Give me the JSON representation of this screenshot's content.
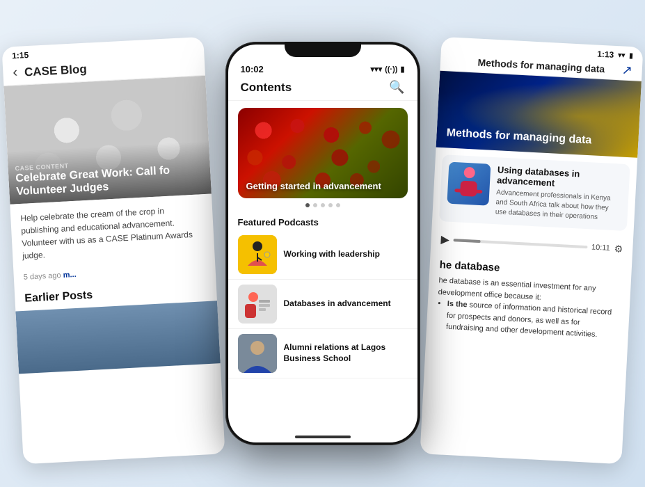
{
  "left_card": {
    "status_time": "1:15",
    "title": "CASE Blog",
    "hero_label": "CASE CONTENT",
    "hero_title": "Celebrate Great Work: Call fo Volunteer Judges",
    "body_text": "Help celebrate the cream of the crop in publishing and educational advancement. Volunteer with us as a CASE Platinum Awards judge.",
    "meta_time": "5 days ago",
    "more_label": "m...",
    "section_title": "Earlier Posts"
  },
  "center_phone": {
    "status_time": "10:02",
    "wifi_icon": "▾",
    "battery_icon": "▮",
    "app_title": "Contents",
    "search_icon": "🔍",
    "slide_label": "Getting started in advancement",
    "dots": [
      "active",
      "inactive",
      "inactive",
      "inactive",
      "inactive"
    ],
    "section_header": "Featured Podcasts",
    "podcasts": [
      {
        "label": "Working with leadership",
        "thumb_type": "yellow-bg",
        "figure_char": "♀"
      },
      {
        "label": "Databases in advancement",
        "thumb_type": "grey-bg",
        "figure_char": ""
      },
      {
        "label": "Alumni relations at Lagos Business School",
        "thumb_type": "photo-bg",
        "figure_char": ""
      }
    ]
  },
  "right_card": {
    "status_time": "1:13",
    "title": "Methods for managing data",
    "share_icon": "↗",
    "banner_text": "Methods for managing data",
    "podcast_title": "Using databases in advancement",
    "podcast_desc": "Advancement professionals in Kenya and South Africa talk about how they use databases in their operations",
    "time_display": "10:11",
    "section_title": "he database",
    "db_intro": "he database is an essential investment for any development office because it:",
    "db_points": [
      "Is the source of information and historical record for prospects and donors, as well as for fundraising and other development activities."
    ]
  }
}
